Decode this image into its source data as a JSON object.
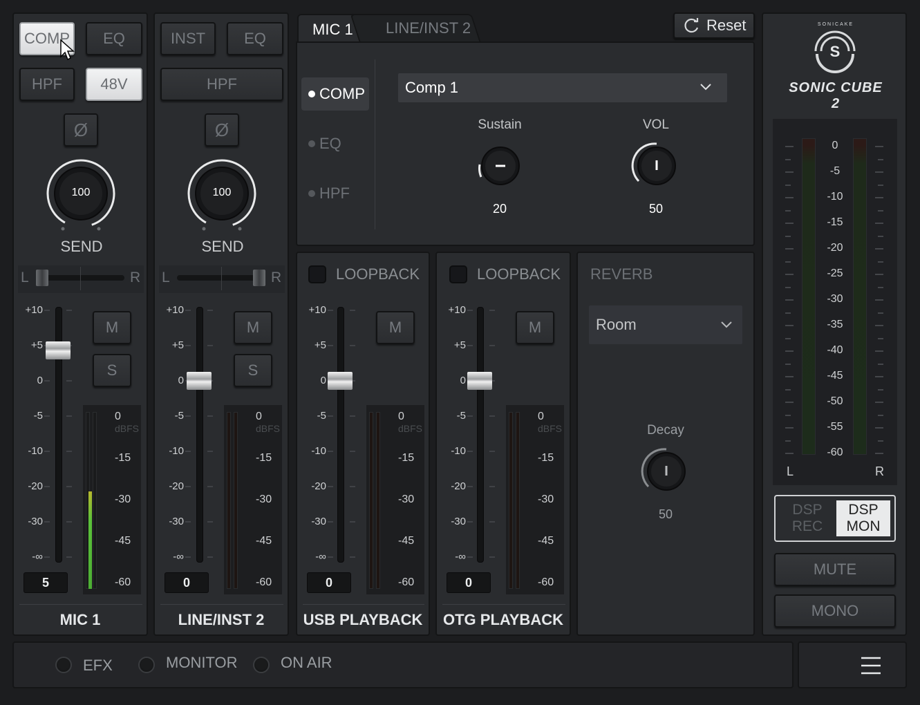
{
  "channels": [
    {
      "name": "MIC 1",
      "buttons": [
        "COMP",
        "EQ",
        "HPF",
        "48V"
      ],
      "send_label": "SEND",
      "send_value": "100",
      "pan_left": "L",
      "pan_right": "R",
      "fader_scale": [
        "+10",
        "+5",
        "0",
        "-5",
        "-10",
        "-20",
        "-30",
        "-∞"
      ],
      "fader_value": "5",
      "mute": "M",
      "solo": "S",
      "meter_scale": [
        "0",
        "dBFS",
        "-15",
        "-30",
        "-45",
        "-60"
      ]
    },
    {
      "name": "LINE/INST 2",
      "buttons": [
        "INST",
        "EQ",
        "HPF"
      ],
      "send_label": "SEND",
      "send_value": "100",
      "pan_left": "L",
      "pan_right": "R",
      "fader_scale": [
        "+10",
        "+5",
        "0",
        "-5",
        "-10",
        "-20",
        "-30",
        "-∞"
      ],
      "fader_value": "0",
      "mute": "M",
      "solo": "S",
      "meter_scale": [
        "0",
        "dBFS",
        "-15",
        "-30",
        "-45",
        "-60"
      ]
    },
    {
      "name": "USB PLAYBACK",
      "loopback": "LOOPBACK",
      "fader_scale": [
        "+10",
        "+5",
        "0",
        "-5",
        "-10",
        "-20",
        "-30",
        "-∞"
      ],
      "fader_value": "0",
      "mute": "M",
      "meter_scale": [
        "0",
        "dBFS",
        "-15",
        "-30",
        "-45",
        "-60"
      ]
    },
    {
      "name": "OTG PLAYBACK",
      "loopback": "LOOPBACK",
      "fader_scale": [
        "+10",
        "+5",
        "0",
        "-5",
        "-10",
        "-20",
        "-30",
        "-∞"
      ],
      "fader_value": "0",
      "mute": "M",
      "meter_scale": [
        "0",
        "dBFS",
        "-15",
        "-30",
        "-45",
        "-60"
      ]
    }
  ],
  "phase_symbol": "Ø",
  "fx_panel": {
    "tabs": [
      "MIC 1",
      "LINE/INST 2"
    ],
    "reset": "Reset",
    "side_items": [
      "COMP",
      "EQ",
      "HPF"
    ],
    "preset": "Comp 1",
    "knobs": [
      {
        "label": "Sustain",
        "value": "20"
      },
      {
        "label": "VOL",
        "value": "50"
      }
    ]
  },
  "reverb": {
    "title": "REVERB",
    "preset": "Room",
    "knob_label": "Decay",
    "knob_value": "50"
  },
  "master": {
    "brand_top": "SONICAKE",
    "product": "SONIC CUBE 2",
    "scale": [
      "0",
      "-5",
      "-10",
      "-15",
      "-20",
      "-25",
      "-30",
      "-35",
      "-40",
      "-45",
      "-50",
      "-55",
      "-60"
    ],
    "left": "L",
    "right": "R",
    "dsp_rec": [
      "DSP",
      "REC"
    ],
    "dsp_mon": [
      "DSP",
      "MON"
    ],
    "mute": "MUTE",
    "mono": "MONO"
  },
  "bottom": {
    "efx": "EFX",
    "monitor": "MONITOR",
    "on_air": "ON AIR"
  },
  "levels": {
    "mic1_meter": 0.55
  }
}
